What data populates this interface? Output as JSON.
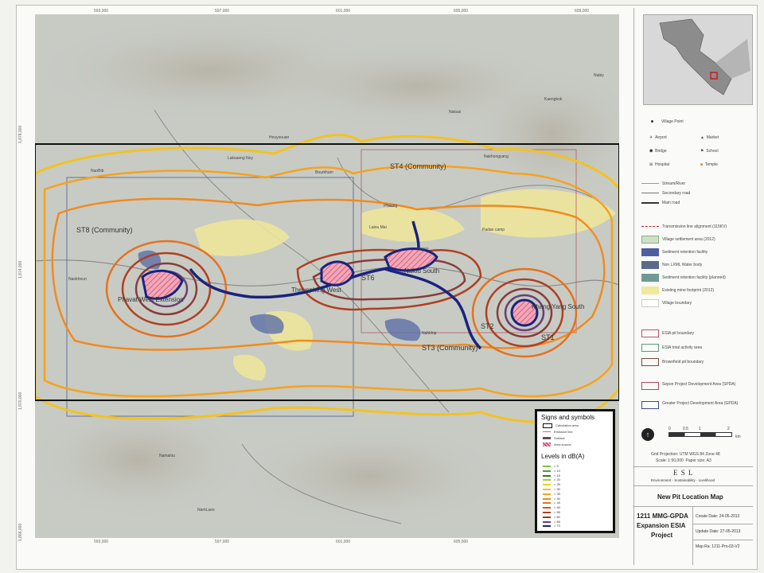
{
  "map": {
    "top_ticks": [
      "593,000",
      "597,000",
      "601,000",
      "605,000",
      "609,000"
    ],
    "bottom_ticks": [
      "593,000",
      "597,000",
      "601,000",
      "605,000"
    ],
    "left_ticks": [
      "1,878,000",
      "1,874,000",
      "1,870,000",
      "1,866,000"
    ],
    "labels": {
      "st8": "ST8 (Community)",
      "st4": "ST4 (Community)",
      "st3": "ST3 (Community)",
      "st6": "ST6",
      "st2": "ST2",
      "st1": "ST1",
      "phavat": "Phavat West Extension",
      "thengkhong": "Theunphing West",
      "nalou": "Nalou South",
      "khangyang": "Khang Yang South",
      "padan": "Padan camp",
      "laksanoy": "Laksaeng Noy",
      "houysouan": "Houysouan",
      "bourkham": "Bourkham",
      "naokheun": "Naokheun",
      "namalou": "Namalou",
      "namlaeo": "NamLaeo",
      "kaengkok": "Kaengkok",
      "nakasi": "Nakasi",
      "nabiy": "Nabiy",
      "nanbib": "NanBib",
      "phaung": "Phaung",
      "nonso": "Nonso",
      "nakhongyang": "Nakhongyang",
      "nahkhip": "Nahkhip",
      "laiou": "Laiou Mai"
    }
  },
  "legend": {
    "signs_title": "Signs and symbols",
    "signs": [
      "Calculation area",
      "Emission line",
      "Surface",
      "Area source"
    ],
    "levels_title": "Levels in dB(A)",
    "levels": [
      ">  5",
      ">  10",
      ">  15",
      ">  20",
      ">  25",
      ">  30",
      ">  35",
      ">  40",
      ">  45",
      ">  50",
      ">  55",
      ">  60",
      ">  65",
      ">  70"
    ],
    "level_colors": [
      "#7dc242",
      "#4f9d2d",
      "#2f7d1a",
      "#b7c42a",
      "#e2d02b",
      "#f4c21f",
      "#f7a21b",
      "#f28a1d",
      "#e6711e",
      "#d6571f",
      "#b23f1f",
      "#8a3a3a",
      "#6b3f72",
      "#1a237e"
    ]
  },
  "key": {
    "village_point": "Village Point",
    "airport": "Airport",
    "market": "Market",
    "bridge": "Bridge",
    "school": "School",
    "hospital": "Hospital",
    "temple": "Temple",
    "stream": "Stream/River",
    "secondary_road": "Secondary road",
    "main_road": "Main road",
    "transmission": "Transmission line alignment (115KV)",
    "settlement": "Village settlement area (2012)",
    "sediment": "Sediment retention facility",
    "nonlxml": "Non LXML Water body",
    "sediment_planned": "Sediment retention facility (planned)",
    "existing_mine": "Existing mine footprint (2012)",
    "village_boundary": "Village boundary",
    "esia_pit": "ESIA pit boundary",
    "esia_total": "ESIA total activity area",
    "brownfield": "Brownfield pit boundary",
    "spda": "Sepon Project Development Area (SPDA)",
    "gpda": "Greater Project Development Area (GPDA)"
  },
  "scalebar": {
    "ticks": [
      "0",
      "0.5",
      "1",
      "2"
    ],
    "unit": "km",
    "projection": "Grid Projection: UTM WGS 84 Zone 48",
    "scale": "Scale:",
    "scale_value": "1:50,000",
    "paper": "Paper size: A3"
  },
  "titleblock": {
    "company": "E S L",
    "tagline": "Environment - Sustainability - Livelihood",
    "map_title": "New Pit Location Map",
    "project_line1": "1211 MMG-GPDA",
    "project_line2": "Expansion ESIA",
    "project_line3": "Project",
    "create_date": "Create Date: 24-05-2013",
    "update_date": "Update Date: 27-05-2013",
    "map_ref": "Map Ra: 1211-Pro-03-V2"
  },
  "colors": {
    "contour_yellow": "#f4c21f",
    "contour_orange": "#f28a1d",
    "contour_brown": "#8a4a3a",
    "contour_navy": "#1a237e",
    "mine_footprint": "#f0e89a",
    "area_source": "#f3a6b8",
    "calc_box": "#111111"
  }
}
